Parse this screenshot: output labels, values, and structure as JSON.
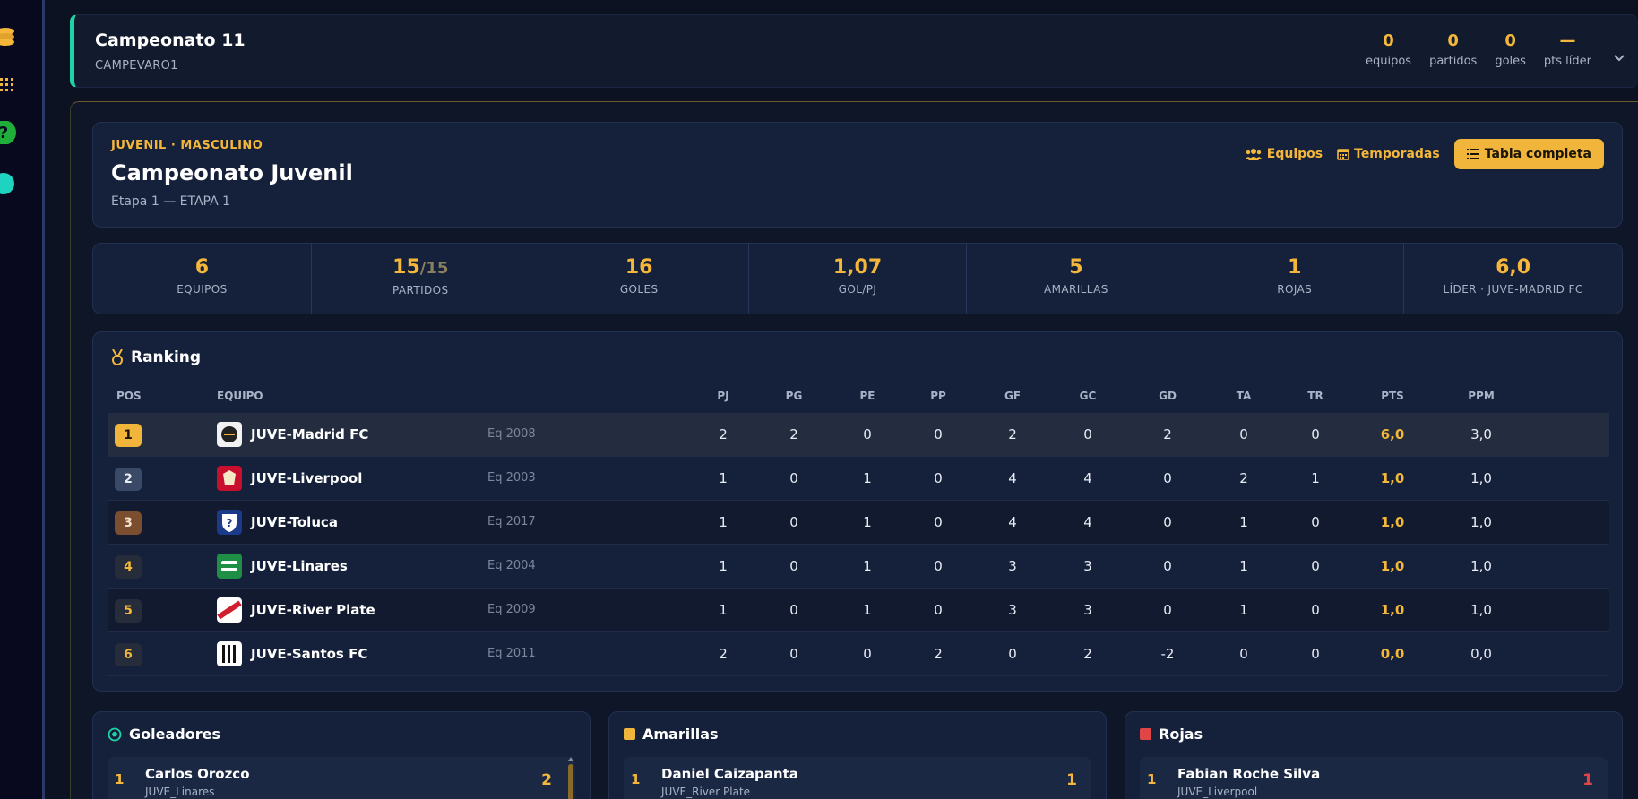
{
  "colors": {
    "accent": "#f4b73a",
    "teal": "#1ed4a6",
    "red": "#e04646",
    "bg": "#0c1222"
  },
  "rail": {
    "icons": [
      "coins-icon",
      "grid-dots-icon",
      "help-icon",
      "status-dot-icon"
    ]
  },
  "championship": {
    "title": "Campeonato 11",
    "code": "CAMPEVARO1",
    "stats": [
      {
        "value": "0",
        "label": "equipos"
      },
      {
        "value": "0",
        "label": "partidos"
      },
      {
        "value": "0",
        "label": "goles"
      },
      {
        "value": "—",
        "label": "pts líder"
      }
    ]
  },
  "header": {
    "tag": "JUVENIL · MASCULINO",
    "title": "Campeonato Juvenil",
    "subtitle": "Etapa 1 — ETAPA 1",
    "actions": {
      "teams": "Equipos",
      "seasons": "Temporadas",
      "full_table": "Tabla completa"
    }
  },
  "stats": [
    {
      "value": "6",
      "extra": "",
      "label": "EQUIPOS"
    },
    {
      "value": "15",
      "extra": "/15",
      "label": "PARTIDOS"
    },
    {
      "value": "16",
      "extra": "",
      "label": "GOLES"
    },
    {
      "value": "1,07",
      "extra": "",
      "label": "GOL/PJ"
    },
    {
      "value": "5",
      "extra": "",
      "label": "AMARILLAS"
    },
    {
      "value": "1",
      "extra": "",
      "label": "ROJAS"
    },
    {
      "value": "6,0",
      "extra": "",
      "label": "LÍDER · JUVE-MADRID FC"
    }
  ],
  "ranking": {
    "title": "Ranking",
    "columns": {
      "pos": "POS",
      "team": "EQUIPO",
      "pj": "PJ",
      "pg": "PG",
      "pe": "PE",
      "pp": "PP",
      "gf": "GF",
      "gc": "GC",
      "gd": "GD",
      "ta": "TA",
      "tr": "TR",
      "pts": "PTS",
      "ppm": "PPM"
    },
    "rows": [
      {
        "pos": "1",
        "name": "JUVE-Madrid FC",
        "eq": "Eq 2008",
        "pj": "2",
        "pg": "2",
        "pe": "0",
        "pp": "0",
        "gf": "2",
        "gc": "0",
        "gd": "2",
        "ta": "0",
        "tr": "0",
        "pts": "6,0",
        "ppm": "3,0"
      },
      {
        "pos": "2",
        "name": "JUVE-Liverpool",
        "eq": "Eq 2003",
        "pj": "1",
        "pg": "0",
        "pe": "1",
        "pp": "0",
        "gf": "4",
        "gc": "4",
        "gd": "0",
        "ta": "2",
        "tr": "1",
        "pts": "1,0",
        "ppm": "1,0"
      },
      {
        "pos": "3",
        "name": "JUVE-Toluca",
        "eq": "Eq 2017",
        "pj": "1",
        "pg": "0",
        "pe": "1",
        "pp": "0",
        "gf": "4",
        "gc": "4",
        "gd": "0",
        "ta": "1",
        "tr": "0",
        "pts": "1,0",
        "ppm": "1,0"
      },
      {
        "pos": "4",
        "name": "JUVE-Linares",
        "eq": "Eq 2004",
        "pj": "1",
        "pg": "0",
        "pe": "1",
        "pp": "0",
        "gf": "3",
        "gc": "3",
        "gd": "0",
        "ta": "1",
        "tr": "0",
        "pts": "1,0",
        "ppm": "1,0"
      },
      {
        "pos": "5",
        "name": "JUVE-River Plate",
        "eq": "Eq 2009",
        "pj": "1",
        "pg": "0",
        "pe": "1",
        "pp": "0",
        "gf": "3",
        "gc": "3",
        "gd": "0",
        "ta": "1",
        "tr": "0",
        "pts": "1,0",
        "ppm": "1,0"
      },
      {
        "pos": "6",
        "name": "JUVE-Santos FC",
        "eq": "Eq 2011",
        "pj": "2",
        "pg": "0",
        "pe": "0",
        "pp": "2",
        "gf": "0",
        "gc": "2",
        "gd": "-2",
        "ta": "0",
        "tr": "0",
        "pts": "0,0",
        "ppm": "0,0"
      }
    ]
  },
  "scorers": {
    "title": "Goleadores",
    "top": {
      "n": "1",
      "name": "Carlos Orozco",
      "team": "JUVE_Linares",
      "value": "2"
    }
  },
  "yellows": {
    "title": "Amarillas",
    "top": {
      "n": "1",
      "name": "Daniel Caizapanta",
      "team": "JUVE_River Plate",
      "value": "1"
    }
  },
  "reds": {
    "title": "Rojas",
    "top": {
      "n": "1",
      "name": "Fabian Roche Silva",
      "team": "JUVE_Liverpool",
      "value": "1"
    }
  }
}
